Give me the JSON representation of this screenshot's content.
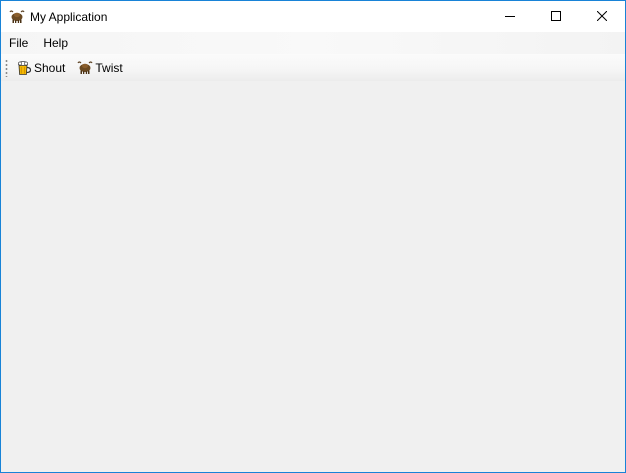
{
  "window": {
    "title": "My Application",
    "icon": "yak-icon",
    "controls": [
      "minimize-icon",
      "maximize-icon",
      "close-icon"
    ],
    "border_color": "#1883d7"
  },
  "menubar": {
    "items": [
      {
        "label": "File"
      },
      {
        "label": "Help"
      }
    ]
  },
  "toolbar": {
    "buttons": [
      {
        "label": "Shout",
        "icon": "beer-mug-icon"
      },
      {
        "label": "Twist",
        "icon": "yak-icon"
      }
    ]
  }
}
